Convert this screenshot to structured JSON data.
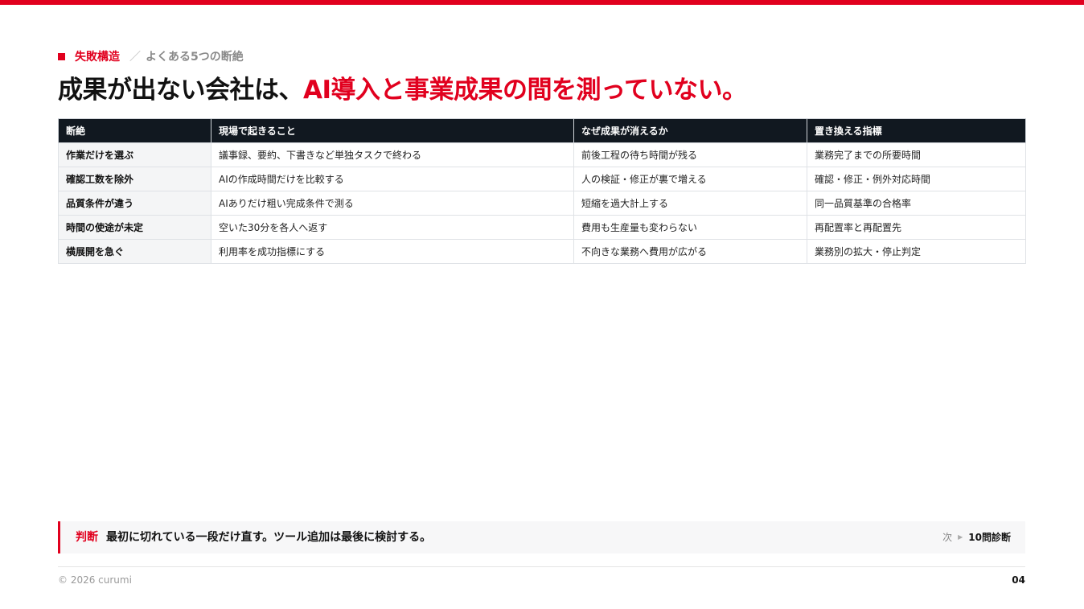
{
  "kicker": {
    "label": "失敗構造",
    "separator": "／",
    "sublabel": "よくある5つの断絶"
  },
  "headline": {
    "lead": "成果が出ない会社は、",
    "accent": "AI導入と事業成果の間を測っていない。"
  },
  "table": {
    "headers": [
      "断絶",
      "現場で起きること",
      "なぜ成果が消えるか",
      "置き換える指標"
    ],
    "rows": [
      [
        "作業だけを選ぶ",
        "議事録、要約、下書きなど単独タスクで終わる",
        "前後工程の待ち時間が残る",
        "業務完了までの所要時間"
      ],
      [
        "確認工数を除外",
        "AIの作成時間だけを比較する",
        "人の検証・修正が裏で増える",
        "確認・修正・例外対応時間"
      ],
      [
        "品質条件が違う",
        "AIありだけ粗い完成条件で測る",
        "短縮を過大計上する",
        "同一品質基準の合格率"
      ],
      [
        "時間の使途が未定",
        "空いた30分を各人へ返す",
        "費用も生産量も変わらない",
        "再配置率と再配置先"
      ],
      [
        "横展開を急ぐ",
        "利用率を成功指標にする",
        "不向きな業務へ費用が広がる",
        "業務別の拡大・停止判定"
      ]
    ]
  },
  "callout": {
    "label": "判断",
    "text": "最初に切れている一段だけ直す。ツール追加は最後に検討する。",
    "next_label": "次",
    "next_icon": "triangle-right-icon",
    "next_target": "10問診断"
  },
  "footer": {
    "copyright": "© 2026 curumi",
    "page": "04"
  },
  "colors": {
    "accent": "#e1001e",
    "header_bg": "#111820"
  }
}
